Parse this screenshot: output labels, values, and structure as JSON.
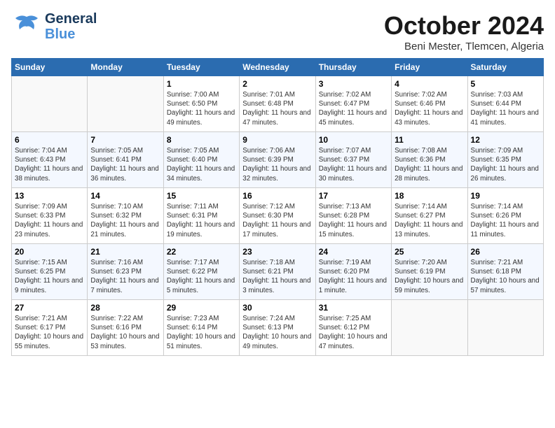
{
  "header": {
    "logo_line1": "General",
    "logo_line2": "Blue",
    "month": "October 2024",
    "location": "Beni Mester, Tlemcen, Algeria"
  },
  "weekdays": [
    "Sunday",
    "Monday",
    "Tuesday",
    "Wednesday",
    "Thursday",
    "Friday",
    "Saturday"
  ],
  "weeks": [
    [
      {
        "day": "",
        "info": ""
      },
      {
        "day": "",
        "info": ""
      },
      {
        "day": "1",
        "info": "Sunrise: 7:00 AM\nSunset: 6:50 PM\nDaylight: 11 hours and 49 minutes."
      },
      {
        "day": "2",
        "info": "Sunrise: 7:01 AM\nSunset: 6:48 PM\nDaylight: 11 hours and 47 minutes."
      },
      {
        "day": "3",
        "info": "Sunrise: 7:02 AM\nSunset: 6:47 PM\nDaylight: 11 hours and 45 minutes."
      },
      {
        "day": "4",
        "info": "Sunrise: 7:02 AM\nSunset: 6:46 PM\nDaylight: 11 hours and 43 minutes."
      },
      {
        "day": "5",
        "info": "Sunrise: 7:03 AM\nSunset: 6:44 PM\nDaylight: 11 hours and 41 minutes."
      }
    ],
    [
      {
        "day": "6",
        "info": "Sunrise: 7:04 AM\nSunset: 6:43 PM\nDaylight: 11 hours and 38 minutes."
      },
      {
        "day": "7",
        "info": "Sunrise: 7:05 AM\nSunset: 6:41 PM\nDaylight: 11 hours and 36 minutes."
      },
      {
        "day": "8",
        "info": "Sunrise: 7:05 AM\nSunset: 6:40 PM\nDaylight: 11 hours and 34 minutes."
      },
      {
        "day": "9",
        "info": "Sunrise: 7:06 AM\nSunset: 6:39 PM\nDaylight: 11 hours and 32 minutes."
      },
      {
        "day": "10",
        "info": "Sunrise: 7:07 AM\nSunset: 6:37 PM\nDaylight: 11 hours and 30 minutes."
      },
      {
        "day": "11",
        "info": "Sunrise: 7:08 AM\nSunset: 6:36 PM\nDaylight: 11 hours and 28 minutes."
      },
      {
        "day": "12",
        "info": "Sunrise: 7:09 AM\nSunset: 6:35 PM\nDaylight: 11 hours and 26 minutes."
      }
    ],
    [
      {
        "day": "13",
        "info": "Sunrise: 7:09 AM\nSunset: 6:33 PM\nDaylight: 11 hours and 23 minutes."
      },
      {
        "day": "14",
        "info": "Sunrise: 7:10 AM\nSunset: 6:32 PM\nDaylight: 11 hours and 21 minutes."
      },
      {
        "day": "15",
        "info": "Sunrise: 7:11 AM\nSunset: 6:31 PM\nDaylight: 11 hours and 19 minutes."
      },
      {
        "day": "16",
        "info": "Sunrise: 7:12 AM\nSunset: 6:30 PM\nDaylight: 11 hours and 17 minutes."
      },
      {
        "day": "17",
        "info": "Sunrise: 7:13 AM\nSunset: 6:28 PM\nDaylight: 11 hours and 15 minutes."
      },
      {
        "day": "18",
        "info": "Sunrise: 7:14 AM\nSunset: 6:27 PM\nDaylight: 11 hours and 13 minutes."
      },
      {
        "day": "19",
        "info": "Sunrise: 7:14 AM\nSunset: 6:26 PM\nDaylight: 11 hours and 11 minutes."
      }
    ],
    [
      {
        "day": "20",
        "info": "Sunrise: 7:15 AM\nSunset: 6:25 PM\nDaylight: 11 hours and 9 minutes."
      },
      {
        "day": "21",
        "info": "Sunrise: 7:16 AM\nSunset: 6:23 PM\nDaylight: 11 hours and 7 minutes."
      },
      {
        "day": "22",
        "info": "Sunrise: 7:17 AM\nSunset: 6:22 PM\nDaylight: 11 hours and 5 minutes."
      },
      {
        "day": "23",
        "info": "Sunrise: 7:18 AM\nSunset: 6:21 PM\nDaylight: 11 hours and 3 minutes."
      },
      {
        "day": "24",
        "info": "Sunrise: 7:19 AM\nSunset: 6:20 PM\nDaylight: 11 hours and 1 minute."
      },
      {
        "day": "25",
        "info": "Sunrise: 7:20 AM\nSunset: 6:19 PM\nDaylight: 10 hours and 59 minutes."
      },
      {
        "day": "26",
        "info": "Sunrise: 7:21 AM\nSunset: 6:18 PM\nDaylight: 10 hours and 57 minutes."
      }
    ],
    [
      {
        "day": "27",
        "info": "Sunrise: 7:21 AM\nSunset: 6:17 PM\nDaylight: 10 hours and 55 minutes."
      },
      {
        "day": "28",
        "info": "Sunrise: 7:22 AM\nSunset: 6:16 PM\nDaylight: 10 hours and 53 minutes."
      },
      {
        "day": "29",
        "info": "Sunrise: 7:23 AM\nSunset: 6:14 PM\nDaylight: 10 hours and 51 minutes."
      },
      {
        "day": "30",
        "info": "Sunrise: 7:24 AM\nSunset: 6:13 PM\nDaylight: 10 hours and 49 minutes."
      },
      {
        "day": "31",
        "info": "Sunrise: 7:25 AM\nSunset: 6:12 PM\nDaylight: 10 hours and 47 minutes."
      },
      {
        "day": "",
        "info": ""
      },
      {
        "day": "",
        "info": ""
      }
    ]
  ]
}
